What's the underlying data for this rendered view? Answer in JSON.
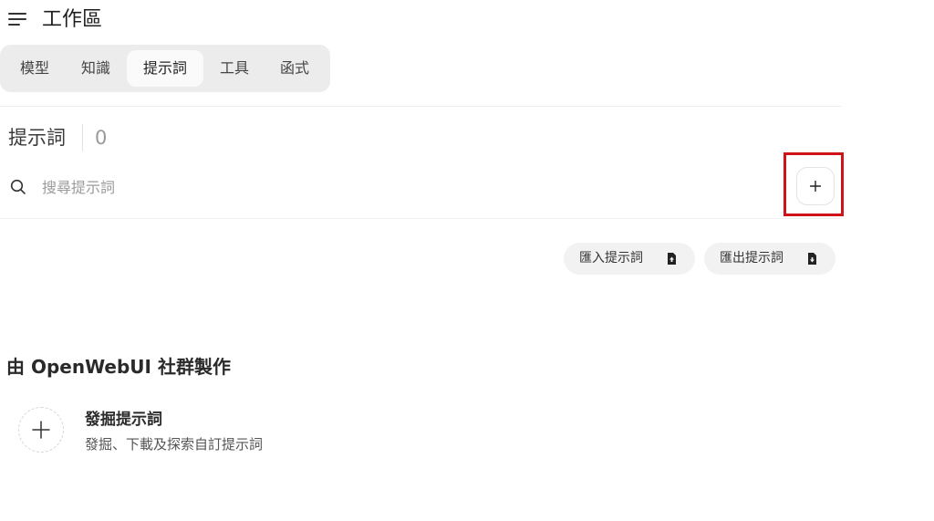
{
  "header": {
    "title": "工作區",
    "menu_icon": "hamburger-icon"
  },
  "tabs": [
    {
      "label": "模型",
      "active": false
    },
    {
      "label": "知識",
      "active": false
    },
    {
      "label": "提示詞",
      "active": true
    },
    {
      "label": "工具",
      "active": false
    },
    {
      "label": "函式",
      "active": false
    }
  ],
  "section": {
    "title": "提示詞",
    "count": "0"
  },
  "search": {
    "placeholder": "搜尋提示詞",
    "value": "",
    "icon": "search-icon"
  },
  "add_button": {
    "icon": "plus-icon",
    "highlight_color": "#d0121b"
  },
  "actions": {
    "import_label": "匯入提示詞",
    "import_icon": "upload-icon",
    "export_label": "匯出提示詞",
    "export_icon": "download-icon"
  },
  "community": {
    "heading": "由 OpenWebUI 社群製作",
    "card_title": "發掘提示詞",
    "card_subtitle": "發掘、下載及探索自訂提示詞",
    "card_icon": "plus-icon"
  }
}
